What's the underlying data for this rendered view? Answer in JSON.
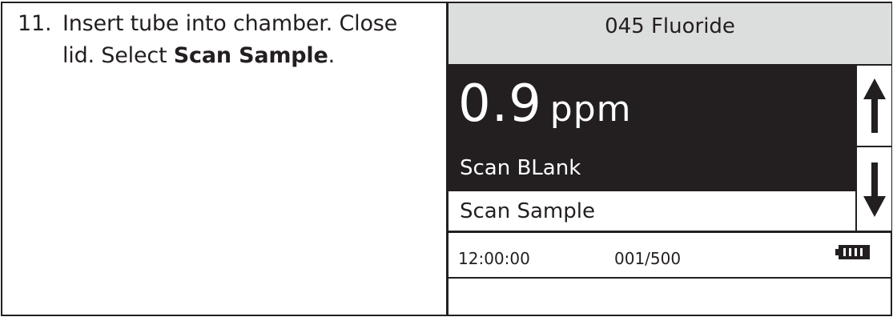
{
  "instruction": {
    "number": "11.",
    "line1": "Insert tube into chamber. Close",
    "line2_prefix": "lid. Select ",
    "line2_bold": "Scan Sample",
    "line2_suffix": "."
  },
  "screen": {
    "title": "045 Fluoride",
    "result": {
      "value": "0.9",
      "unit": "ppm"
    },
    "menu": {
      "items": [
        {
          "label": "Scan BLank",
          "selected": true
        },
        {
          "label": "Scan Sample",
          "selected": false
        }
      ]
    },
    "scroll_icons": [
      "arrow-up-icon",
      "arrow-down-icon"
    ],
    "status": {
      "time": "12:00:00",
      "count": "001/500",
      "battery_icon": "battery-full-icon"
    }
  },
  "colors": {
    "ink": "#231f20",
    "title_bg": "#dcdddd",
    "background": "#ffffff"
  }
}
